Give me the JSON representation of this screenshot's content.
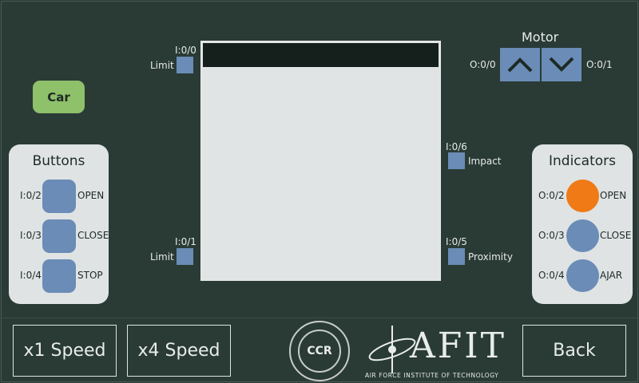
{
  "car": {
    "label": "Car"
  },
  "motor": {
    "title": "Motor",
    "up_addr": "O:0/0",
    "down_addr": "O:0/1"
  },
  "buttons_panel": {
    "title": "Buttons",
    "items": [
      {
        "addr": "I:0/2",
        "label": "OPEN"
      },
      {
        "addr": "I:0/3",
        "label": "CLOSE"
      },
      {
        "addr": "I:0/4",
        "label": "STOP"
      }
    ]
  },
  "indicators_panel": {
    "title": "Indicators",
    "items": [
      {
        "addr": "O:0/2",
        "label": "OPEN",
        "state": "on"
      },
      {
        "addr": "O:0/3",
        "label": "CLOSE",
        "state": "off"
      },
      {
        "addr": "O:0/4",
        "label": "AJAR",
        "state": "off"
      }
    ]
  },
  "sensors": {
    "limit_top": {
      "addr": "I:0/0",
      "label": "Limit"
    },
    "limit_bottom": {
      "addr": "I:0/1",
      "label": "Limit"
    },
    "impact": {
      "addr": "I:0/6",
      "label": "Impact"
    },
    "proximity": {
      "addr": "I:0/5",
      "label": "Proximity"
    }
  },
  "footer": {
    "speed1": "x1 Speed",
    "speed4": "x4 Speed",
    "back": "Back",
    "ccr_logo": "CCR",
    "afit_logo": "AFIT",
    "afit_tagline": "Air Force Institute of Technology"
  },
  "colors": {
    "background": "#2a3b36",
    "accent_blue": "#6a8cb6",
    "indicator_on": "#ef7a16",
    "car_button": "#8fc06a",
    "panel": "#dfe3e4"
  }
}
